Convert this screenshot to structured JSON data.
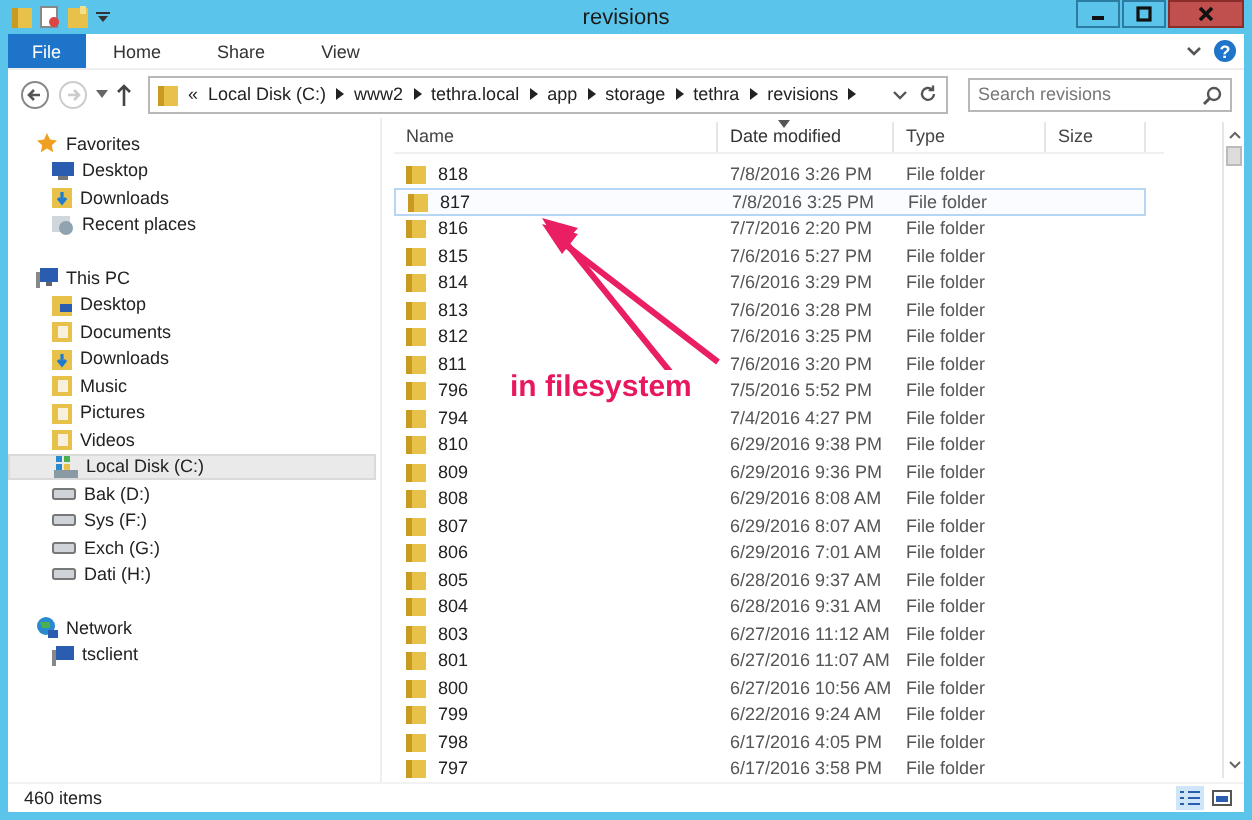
{
  "window": {
    "title": "revisions"
  },
  "ribbon": {
    "tabs": [
      {
        "label": "File",
        "selected": true
      },
      {
        "label": "Home",
        "selected": false
      },
      {
        "label": "Share",
        "selected": false
      },
      {
        "label": "View",
        "selected": false
      }
    ],
    "help": "?"
  },
  "address": {
    "overflow": "«",
    "segments": [
      "Local Disk (C:)",
      "www2",
      "tethra.local",
      "app",
      "storage",
      "tethra",
      "revisions"
    ]
  },
  "search": {
    "placeholder": "Search revisions"
  },
  "sidebar": {
    "groups": [
      {
        "label": "Favorites",
        "kind": "star",
        "children": [
          {
            "label": "Desktop",
            "kind": "desktop",
            "selected": false
          },
          {
            "label": "Downloads",
            "kind": "downloads",
            "selected": false
          },
          {
            "label": "Recent places",
            "kind": "recent",
            "selected": false
          }
        ]
      },
      {
        "label": "This PC",
        "kind": "pc",
        "children": [
          {
            "label": "Desktop",
            "kind": "desktop-folder",
            "selected": false
          },
          {
            "label": "Documents",
            "kind": "folder",
            "selected": false
          },
          {
            "label": "Downloads",
            "kind": "downloads",
            "selected": false
          },
          {
            "label": "Music",
            "kind": "folder",
            "selected": false
          },
          {
            "label": "Pictures",
            "kind": "folder",
            "selected": false
          },
          {
            "label": "Videos",
            "kind": "folder",
            "selected": false
          },
          {
            "label": "Local Disk (C:)",
            "kind": "system-drive",
            "selected": true
          },
          {
            "label": "Bak (D:)",
            "kind": "drive",
            "selected": false
          },
          {
            "label": "Sys (F:)",
            "kind": "drive",
            "selected": false
          },
          {
            "label": "Exch (G:)",
            "kind": "drive",
            "selected": false
          },
          {
            "label": "Dati (H:)",
            "kind": "drive",
            "selected": false
          }
        ]
      },
      {
        "label": "Network",
        "kind": "network",
        "children": [
          {
            "label": "tsclient",
            "kind": "pc",
            "selected": false
          }
        ]
      }
    ]
  },
  "table": {
    "columns": [
      {
        "label": "Name",
        "sorted": false
      },
      {
        "label": "Date modified",
        "sorted": true
      },
      {
        "label": "Type",
        "sorted": false
      },
      {
        "label": "Size",
        "sorted": false
      }
    ],
    "rows": [
      {
        "name": "818",
        "date": "7/8/2016 3:26 PM",
        "type": "File folder",
        "selected": false
      },
      {
        "name": "817",
        "date": "7/8/2016 3:25 PM",
        "type": "File folder",
        "selected": true
      },
      {
        "name": "816",
        "date": "7/7/2016 2:20 PM",
        "type": "File folder",
        "selected": false
      },
      {
        "name": "815",
        "date": "7/6/2016 5:27 PM",
        "type": "File folder",
        "selected": false
      },
      {
        "name": "814",
        "date": "7/6/2016 3:29 PM",
        "type": "File folder",
        "selected": false
      },
      {
        "name": "813",
        "date": "7/6/2016 3:28 PM",
        "type": "File folder",
        "selected": false
      },
      {
        "name": "812",
        "date": "7/6/2016 3:25 PM",
        "type": "File folder",
        "selected": false
      },
      {
        "name": "811",
        "date": "7/6/2016 3:20 PM",
        "type": "File folder",
        "selected": false
      },
      {
        "name": "796",
        "date": "7/5/2016 5:52 PM",
        "type": "File folder",
        "selected": false
      },
      {
        "name": "794",
        "date": "7/4/2016 4:27 PM",
        "type": "File folder",
        "selected": false
      },
      {
        "name": "810",
        "date": "6/29/2016 9:38 PM",
        "type": "File folder",
        "selected": false
      },
      {
        "name": "809",
        "date": "6/29/2016 9:36 PM",
        "type": "File folder",
        "selected": false
      },
      {
        "name": "808",
        "date": "6/29/2016 8:08 AM",
        "type": "File folder",
        "selected": false
      },
      {
        "name": "807",
        "date": "6/29/2016 8:07 AM",
        "type": "File folder",
        "selected": false
      },
      {
        "name": "806",
        "date": "6/29/2016 7:01 AM",
        "type": "File folder",
        "selected": false
      },
      {
        "name": "805",
        "date": "6/28/2016 9:37 AM",
        "type": "File folder",
        "selected": false
      },
      {
        "name": "804",
        "date": "6/28/2016 9:31 AM",
        "type": "File folder",
        "selected": false
      },
      {
        "name": "803",
        "date": "6/27/2016 11:12 AM",
        "type": "File folder",
        "selected": false
      },
      {
        "name": "801",
        "date": "6/27/2016 11:07 AM",
        "type": "File folder",
        "selected": false
      },
      {
        "name": "800",
        "date": "6/27/2016 10:56 AM",
        "type": "File folder",
        "selected": false
      },
      {
        "name": "799",
        "date": "6/22/2016 9:24 AM",
        "type": "File folder",
        "selected": false
      },
      {
        "name": "798",
        "date": "6/17/2016 4:05 PM",
        "type": "File folder",
        "selected": false
      },
      {
        "name": "797",
        "date": "6/17/2016 3:58 PM",
        "type": "File folder",
        "selected": false
      }
    ]
  },
  "annotation": {
    "text": "in filesystem"
  },
  "status_bar": {
    "count": "460 items"
  }
}
